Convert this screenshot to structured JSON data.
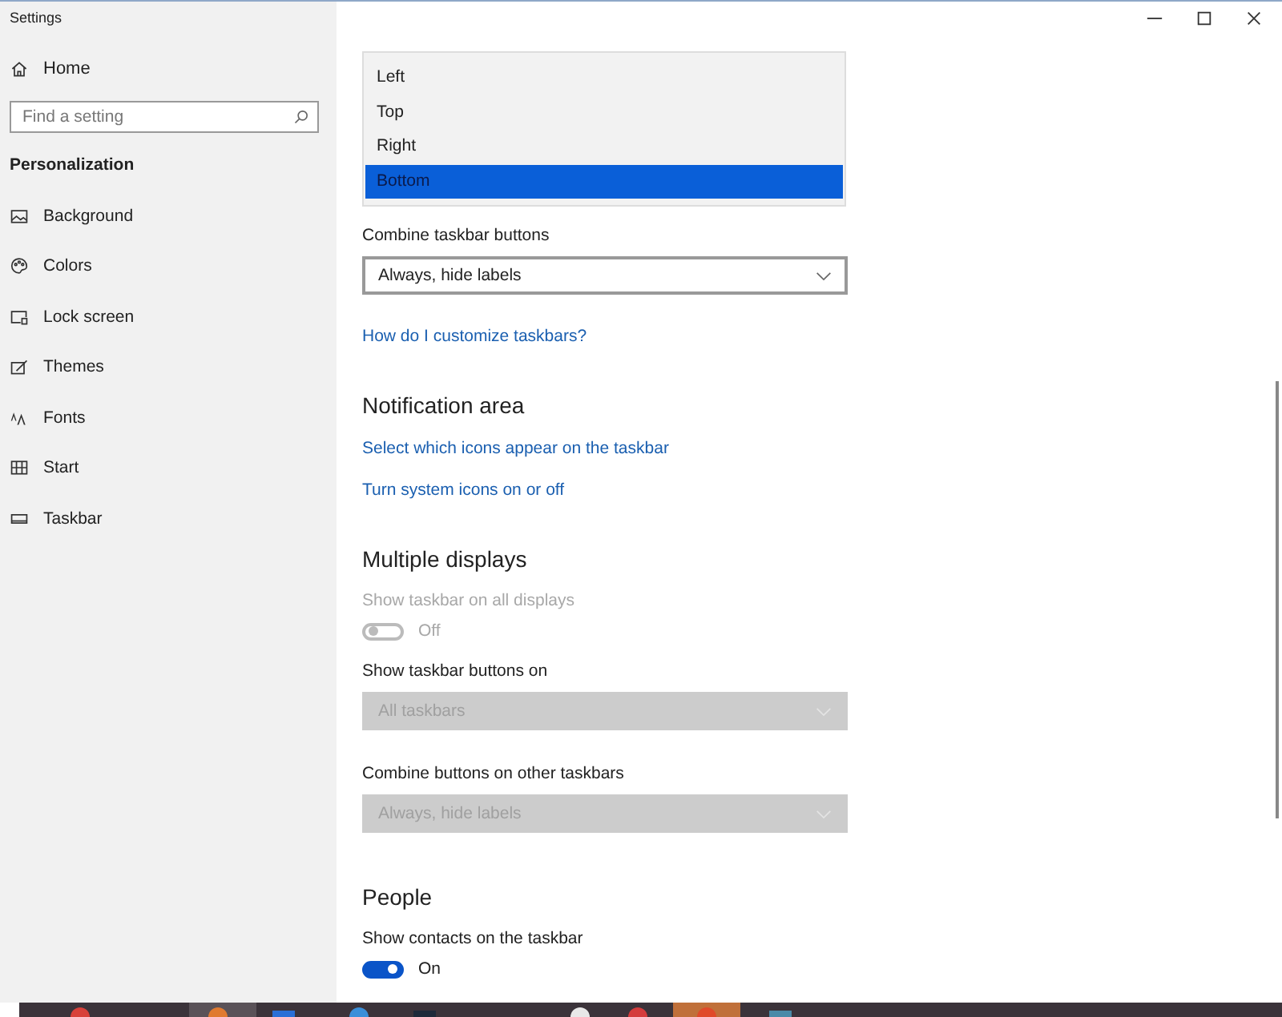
{
  "window": {
    "title": "Settings"
  },
  "sidebar": {
    "home": "Home",
    "search": {
      "placeholder": "Find a setting"
    },
    "section": "Personalization",
    "items": [
      {
        "label": "Background"
      },
      {
        "label": "Colors"
      },
      {
        "label": "Lock screen"
      },
      {
        "label": "Themes"
      },
      {
        "label": "Fonts"
      },
      {
        "label": "Start"
      },
      {
        "label": "Taskbar"
      }
    ]
  },
  "position_list": {
    "options": [
      {
        "label": "Left",
        "selected": false
      },
      {
        "label": "Top",
        "selected": false
      },
      {
        "label": "Right",
        "selected": false
      },
      {
        "label": "Bottom",
        "selected": true
      }
    ]
  },
  "settings": [
    {
      "kind": "dropdown",
      "label": "Combine taskbar buttons",
      "value": "Always, hide labels",
      "disabled": false
    },
    {
      "kind": "link",
      "text": "How do I customize taskbars?"
    },
    {
      "kind": "heading",
      "text": "Notification area"
    },
    {
      "kind": "link",
      "text": "Select which icons appear on the taskbar"
    },
    {
      "kind": "link",
      "text": "Turn system icons on or off"
    },
    {
      "kind": "heading",
      "text": "Multiple displays"
    },
    {
      "kind": "toggle",
      "label": "Show taskbar on all displays",
      "on": false,
      "state_text": "Off",
      "disabled": true
    },
    {
      "kind": "dropdown",
      "label": "Show taskbar buttons on",
      "value": "All taskbars",
      "disabled": true
    },
    {
      "kind": "dropdown",
      "label": "Combine buttons on other taskbars",
      "value": "Always, hide labels",
      "disabled": true
    },
    {
      "kind": "heading",
      "text": "People"
    },
    {
      "kind": "toggle",
      "label": "Show contacts on the taskbar",
      "on": true,
      "state_text": "On",
      "disabled": false
    }
  ]
}
